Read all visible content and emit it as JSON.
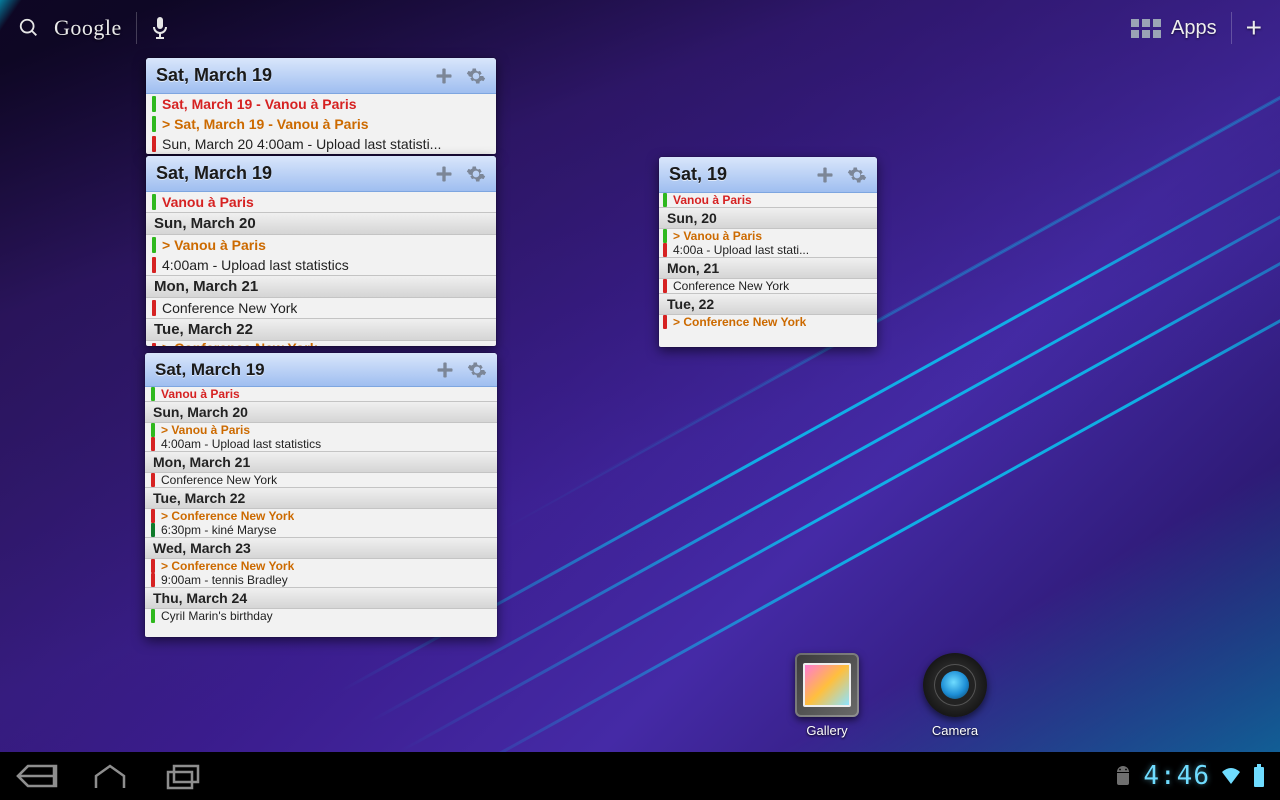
{
  "topbar": {
    "search_label": "Google",
    "apps_label": "Apps"
  },
  "widgets": {
    "w1": {
      "title": "Sat, March 19",
      "rows": [
        {
          "type": "ev",
          "bar": "green",
          "style": "red",
          "text": "Sat, March 19 - Vanou à Paris"
        },
        {
          "type": "ev",
          "bar": "green",
          "style": "orange",
          "text": "> Sat, March 19 - Vanou à Paris"
        },
        {
          "type": "ev",
          "bar": "red",
          "style": "",
          "text": "Sun, March 20 4:00am - Upload last statisti..."
        }
      ]
    },
    "w2": {
      "title": "Sat, March 19",
      "rows": [
        {
          "type": "ev",
          "bar": "green",
          "style": "red",
          "text": "Vanou à Paris"
        },
        {
          "type": "sep",
          "text": "Sun, March 20"
        },
        {
          "type": "ev",
          "bar": "green",
          "style": "orange",
          "text": "> Vanou à Paris"
        },
        {
          "type": "ev",
          "bar": "red",
          "style": "",
          "text": "4:00am - Upload last statistics"
        },
        {
          "type": "sep",
          "text": "Mon, March 21"
        },
        {
          "type": "ev",
          "bar": "red",
          "style": "",
          "text": "Conference New York"
        },
        {
          "type": "sep",
          "text": "Tue, March 22"
        },
        {
          "type": "ev",
          "bar": "red",
          "style": "orange",
          "text": "> Conference New York",
          "cut": true
        }
      ]
    },
    "w3": {
      "title": "Sat, March 19",
      "rows": [
        {
          "type": "ev",
          "bar": "green",
          "style": "red",
          "text": "Vanou à Paris"
        },
        {
          "type": "sep",
          "text": "Sun, March 20"
        },
        {
          "type": "ev",
          "bar": "green",
          "style": "orange",
          "text": "> Vanou à Paris"
        },
        {
          "type": "ev",
          "bar": "red",
          "style": "",
          "text": "4:00am - Upload last statistics"
        },
        {
          "type": "sep",
          "text": "Mon, March 21"
        },
        {
          "type": "ev",
          "bar": "red",
          "style": "",
          "text": "Conference New York"
        },
        {
          "type": "sep",
          "text": "Tue, March 22"
        },
        {
          "type": "ev",
          "bar": "red",
          "style": "orange",
          "text": "> Conference New York"
        },
        {
          "type": "ev",
          "bar": "dgreen",
          "style": "",
          "text": "6:30pm - kiné Maryse"
        },
        {
          "type": "sep",
          "text": "Wed, March 23"
        },
        {
          "type": "ev",
          "bar": "red",
          "style": "orange",
          "text": "> Conference New York"
        },
        {
          "type": "ev",
          "bar": "red",
          "style": "",
          "text": "9:00am - tennis Bradley"
        },
        {
          "type": "sep",
          "text": "Thu, March 24"
        },
        {
          "type": "ev",
          "bar": "green",
          "style": "",
          "text": "Cyril Marin's birthday",
          "cut": true
        }
      ]
    },
    "w4": {
      "title": "Sat, 19",
      "rows": [
        {
          "type": "ev",
          "bar": "green",
          "style": "red",
          "text": "Vanou à Paris"
        },
        {
          "type": "sep",
          "text": "Sun, 20"
        },
        {
          "type": "ev",
          "bar": "green",
          "style": "orange",
          "text": "> Vanou à Paris"
        },
        {
          "type": "ev",
          "bar": "red",
          "style": "",
          "text": "4:00a - Upload last stati..."
        },
        {
          "type": "sep",
          "text": "Mon, 21"
        },
        {
          "type": "ev",
          "bar": "red",
          "style": "",
          "text": "Conference New York"
        },
        {
          "type": "sep",
          "text": "Tue, 22"
        },
        {
          "type": "ev",
          "bar": "red",
          "style": "orange",
          "text": "> Conference New York"
        }
      ]
    }
  },
  "dock": {
    "gallery": "Gallery",
    "camera": "Camera"
  },
  "sysbar": {
    "time": "4:46"
  }
}
